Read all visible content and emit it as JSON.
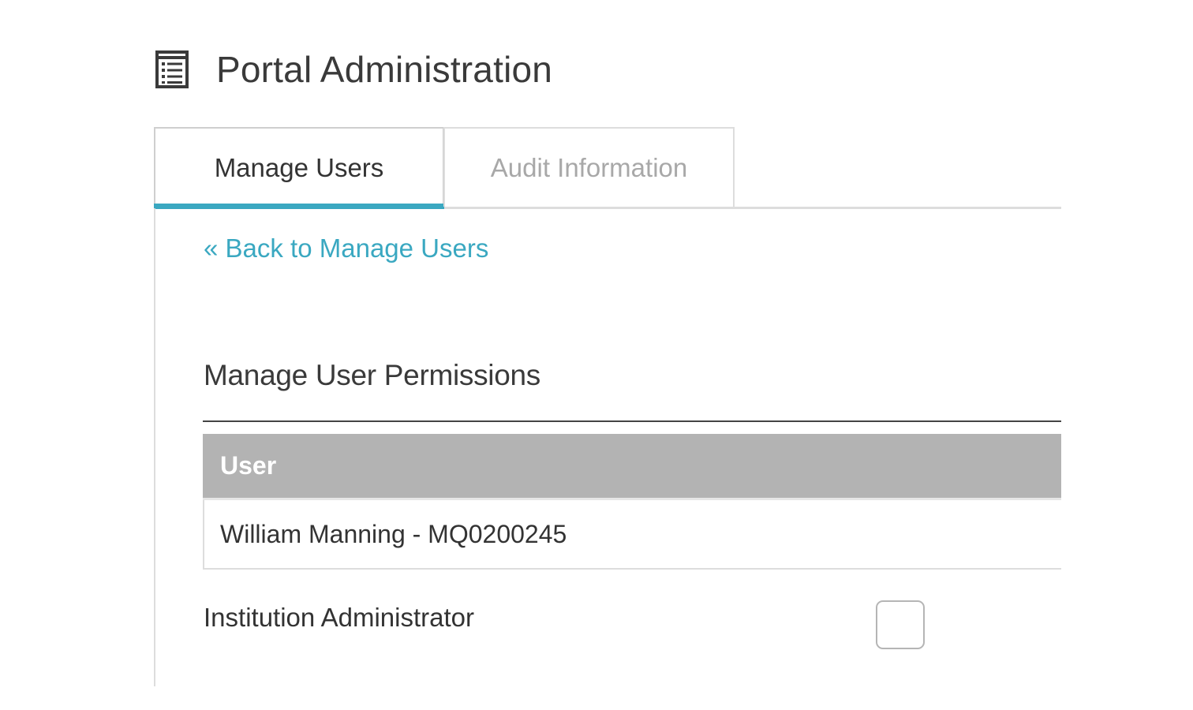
{
  "header": {
    "title": "Portal Administration",
    "icon": "list-icon"
  },
  "tabs": [
    {
      "label": "Manage Users",
      "active": true
    },
    {
      "label": "Audit Information",
      "active": false
    }
  ],
  "back_link": {
    "label": "« Back to Manage Users"
  },
  "section": {
    "title": "Manage User Permissions"
  },
  "user_table": {
    "column_header": "User",
    "rows": [
      {
        "user": "William Manning - MQ0200245"
      }
    ]
  },
  "permissions": [
    {
      "label": "Institution Administrator",
      "checked": false
    }
  ],
  "colors": {
    "accent": "#3aa8c1",
    "table_header_bg": "#b3b3b3",
    "border": "#dddddd"
  }
}
